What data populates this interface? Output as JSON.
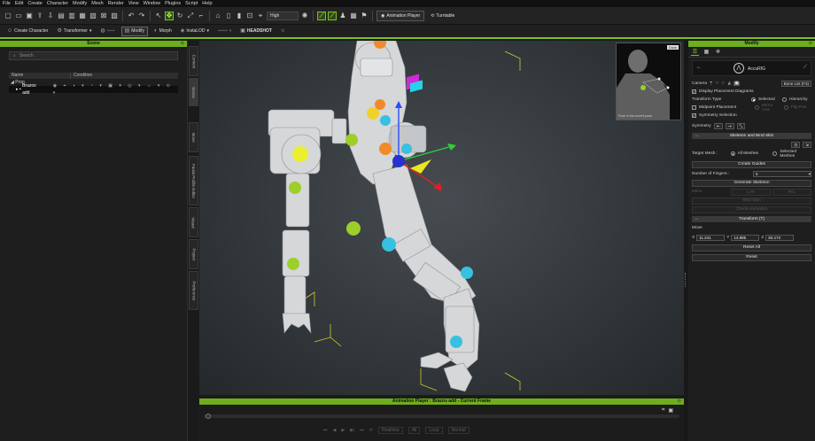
{
  "menu": [
    "File",
    "Edit",
    "Create",
    "Character",
    "Modify",
    "Mesh",
    "Render",
    "View",
    "Window",
    "Plugins",
    "Script",
    "Help"
  ],
  "toolbar": {
    "quality": "High",
    "animation_player": "Animation Player",
    "turntable": "Turntable"
  },
  "toolbar2": {
    "create_character": "Create Character",
    "transformer": "Transformer",
    "modify": "Modify",
    "morph": "Morph",
    "instalod": "InstaLOD",
    "headshot": "HEADSHOT"
  },
  "scene": {
    "title": "Scene",
    "search_placeholder": "Search",
    "col_name": "Name",
    "col_condition": "Condition",
    "items": [
      {
        "label": "Prop"
      },
      {
        "label": "Brazos add"
      }
    ]
  },
  "side_tabs": [
    "Content",
    "Scene",
    "Bone",
    "Facial Profile Editor",
    "Visual",
    "Project",
    "Preference"
  ],
  "inset": {
    "dock": "Dock",
    "caption": "Pose in the current pose"
  },
  "anim": {
    "title": "Animation Player : Brazos add - Current Frame",
    "realtime": "Realtime",
    "speed": "All",
    "frame": "Loop",
    "mode": "Normal"
  },
  "modify": {
    "title": "Modify",
    "character_name": "AccuRIG",
    "camera": "Camera",
    "bone_list": "Bone List (F3)",
    "display_placement": "Display Placement Diagrams",
    "transform_type": "Transform Type",
    "selected": "Selected",
    "hierarchy": "Hierarchy",
    "midpoint": "Midpoint Placement",
    "mirror_axis": "Mirror Axis",
    "flip_pos": "Flip Pos",
    "symmetry_selection": "Symmetry Selection",
    "symmetry": "Symmetry",
    "skeleton_section": "Skeleton and Bind Skin",
    "target_mesh": "Target Mesh :",
    "all_meshes": "All Meshes",
    "selected_meshes": "Selected Meshes",
    "create_guides": "Create Guides",
    "num_fingers_label": "Number of Fingers :",
    "num_fingers_value": "5",
    "generate_skeleton": "Generate Skeleton",
    "mirror": "Mirror",
    "l_r": "L>R",
    "r_l": "R<L",
    "bind_skin": "Bind Skin",
    "check_animation": "Check Animation",
    "transform_section": "Transform (T)",
    "move": "Move",
    "x_val": "11.241",
    "y_val": "14.885",
    "z_val": "83.174",
    "reset_all": "Reset All",
    "reset": "Reset"
  },
  "colors": {
    "accent": "#7dc021",
    "panel_title": "#6eae1c"
  }
}
